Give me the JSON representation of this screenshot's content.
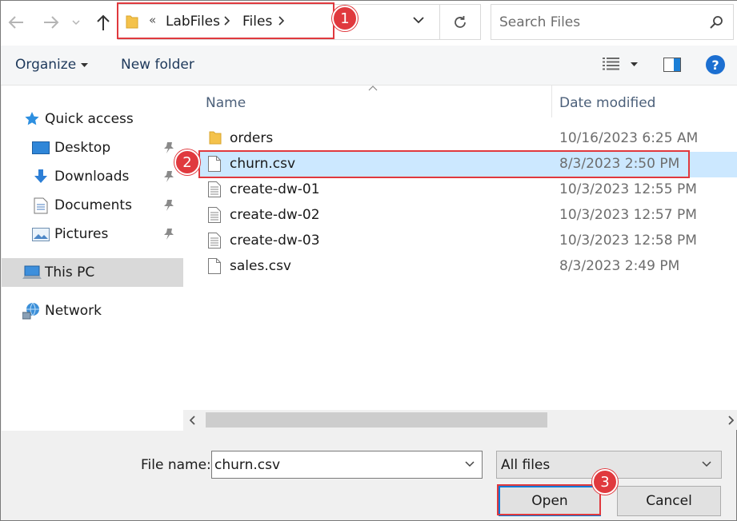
{
  "address": {
    "overflow": "«",
    "segments": [
      "LabFiles",
      "Files"
    ]
  },
  "search": {
    "placeholder": "Search Files"
  },
  "toolbar": {
    "organize": "Organize",
    "new_folder": "New folder",
    "help_glyph": "?"
  },
  "sidebar": {
    "items": [
      {
        "label": "Quick access",
        "icon": "star-icon"
      },
      {
        "label": "Desktop",
        "icon": "desktop-icon",
        "pinned": true
      },
      {
        "label": "Downloads",
        "icon": "download-arrow-icon",
        "pinned": true
      },
      {
        "label": "Documents",
        "icon": "document-icon",
        "pinned": true
      },
      {
        "label": "Pictures",
        "icon": "picture-icon",
        "pinned": true
      },
      {
        "label": "This PC",
        "icon": "computer-icon",
        "selected": true
      },
      {
        "label": "Network",
        "icon": "network-icon"
      }
    ]
  },
  "columns": {
    "name": "Name",
    "date": "Date modified"
  },
  "files": [
    {
      "name": "orders",
      "date": "10/16/2023 6:25 AM",
      "kind": "folder"
    },
    {
      "name": "churn.csv",
      "date": "8/3/2023 2:50 PM",
      "kind": "file",
      "selected": true
    },
    {
      "name": "create-dw-01",
      "date": "10/3/2023 12:55 PM",
      "kind": "text"
    },
    {
      "name": "create-dw-02",
      "date": "10/3/2023 12:57 PM",
      "kind": "text"
    },
    {
      "name": "create-dw-03",
      "date": "10/3/2023 12:58 PM",
      "kind": "text"
    },
    {
      "name": "sales.csv",
      "date": "8/3/2023 2:49 PM",
      "kind": "file"
    }
  ],
  "bottom": {
    "file_name_label": "File name:",
    "file_name_value": "churn.csv",
    "file_type": "All files",
    "open_label": "Open",
    "cancel_label": "Cancel"
  },
  "annotations": [
    "1",
    "2",
    "3"
  ],
  "colors": {
    "annotation": "#e0393e",
    "selection": "#cce8ff",
    "accent": "#0078d7"
  }
}
